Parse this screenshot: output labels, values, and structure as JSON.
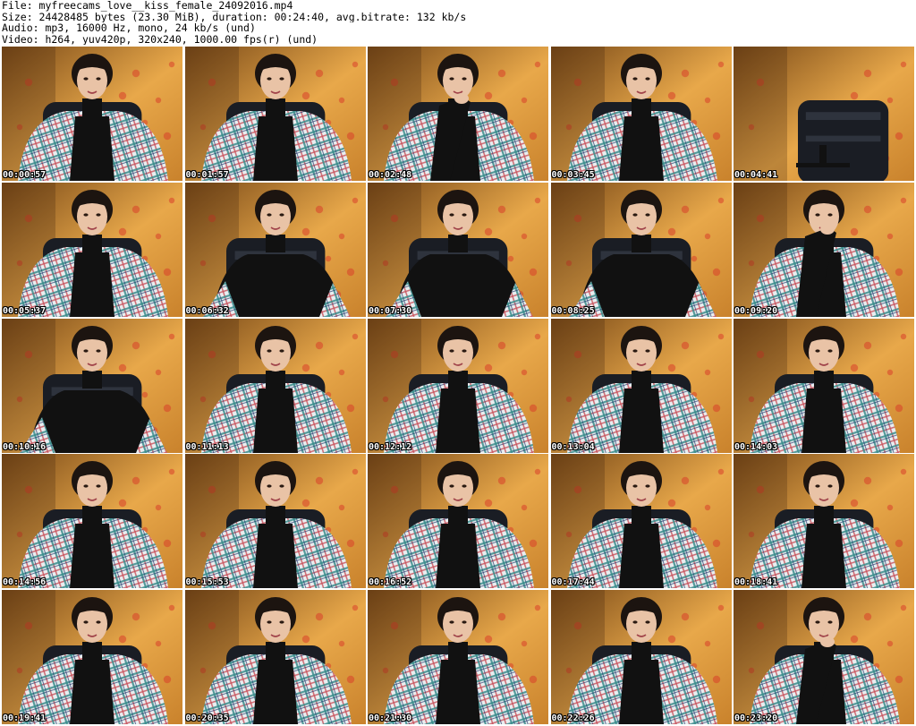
{
  "header": {
    "file_line": "File: myfreecams_love__kiss_female_24092016.mp4",
    "size_line": "Size: 24428485 bytes (23.30 MiB), duration: 00:24:40, avg.bitrate: 132 kb/s",
    "audio_line": "Audio: mp3, 16000 Hz, mono, 24 kb/s (und)",
    "video_line": "Video: h264, yuv420p, 320x240, 1000.00 fps(r) (und)"
  },
  "thumbnails": [
    {
      "timestamp": "00:00:57",
      "scene": "blanket"
    },
    {
      "timestamp": "00:01:57",
      "scene": "blanket"
    },
    {
      "timestamp": "00:02:48",
      "scene": "hand-chin"
    },
    {
      "timestamp": "00:03:45",
      "scene": "blanket"
    },
    {
      "timestamp": "00:04:41",
      "scene": "empty-chair"
    },
    {
      "timestamp": "00:05:37",
      "scene": "blanket"
    },
    {
      "timestamp": "00:06:32",
      "scene": "dark-shawl"
    },
    {
      "timestamp": "00:07:30",
      "scene": "dark-shawl"
    },
    {
      "timestamp": "00:08:25",
      "scene": "dark-shawl"
    },
    {
      "timestamp": "00:09:20",
      "scene": "hand-mouth"
    },
    {
      "timestamp": "00:10:16",
      "scene": "dark-shawl"
    },
    {
      "timestamp": "00:11:13",
      "scene": "blanket"
    },
    {
      "timestamp": "00:12:12",
      "scene": "blanket"
    },
    {
      "timestamp": "00:13:04",
      "scene": "blanket"
    },
    {
      "timestamp": "00:14:03",
      "scene": "blanket"
    },
    {
      "timestamp": "00:14:56",
      "scene": "blanket"
    },
    {
      "timestamp": "00:15:53",
      "scene": "blanket"
    },
    {
      "timestamp": "00:16:52",
      "scene": "blanket"
    },
    {
      "timestamp": "00:17:44",
      "scene": "blanket"
    },
    {
      "timestamp": "00:18:41",
      "scene": "blanket"
    },
    {
      "timestamp": "00:19:41",
      "scene": "blanket"
    },
    {
      "timestamp": "00:20:35",
      "scene": "blanket"
    },
    {
      "timestamp": "00:21:30",
      "scene": "blanket"
    },
    {
      "timestamp": "00:22:26",
      "scene": "blanket"
    },
    {
      "timestamp": "00:23:20",
      "scene": "hand-chin"
    }
  ],
  "colors": {
    "wall_light": "#e8a84a",
    "wall_dark": "#7a4a18",
    "flower": "#d8402a",
    "skin": "#e9c3a6",
    "hair": "#1c1410",
    "top": "#111111",
    "chair": "#1a1d24",
    "blanket_base": "#e9eef0",
    "blanket_red": "#c8505a",
    "blanket_teal": "#3a8c8c",
    "blanket_navy": "#283c6e",
    "timestamp_fill": "#ffffff",
    "timestamp_outline": "#000000"
  }
}
